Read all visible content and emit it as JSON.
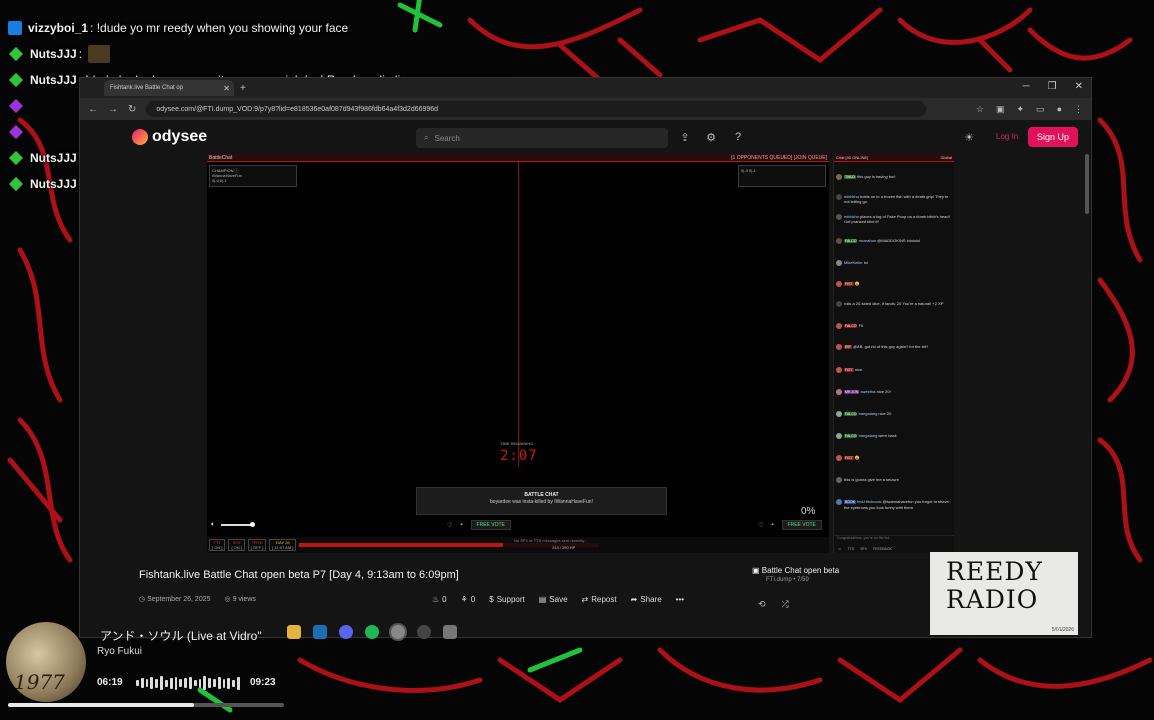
{
  "overlay_chat": [
    {
      "icon": "twitch",
      "user": "vizzyboi_1",
      "text": ": !dude yo mr reedy when you showing your face"
    },
    {
      "icon": "diamond-green",
      "user": "NutsJJJ",
      "text": ":"
    },
    {
      "icon": "diamond-green",
      "user": "NutsJJJ",
      "text": ": !dude ha ha ha aye man its your special day! Reedy radio live wowowowowoeee"
    },
    {
      "icon": "diamond-purple",
      "user": "",
      "text": ""
    },
    {
      "icon": "diamond-purple",
      "user": "",
      "text": ""
    },
    {
      "icon": "diamond-green",
      "user": "NutsJJJ",
      "text": ":"
    },
    {
      "icon": "diamond-green",
      "user": "NutsJJJ",
      "text": ":"
    }
  ],
  "browser": {
    "tab_title": "Fishtank.live Battle Chat op",
    "url": "odysee.com/@FTI.dump_VOD:9/p7y8?lid=e818536e0af087d943f986fdb64a4f3d2d66996d"
  },
  "site": {
    "logo": "odysee",
    "search_placeholder": "Search",
    "login": "Log In",
    "signup": "Sign Up"
  },
  "player": {
    "header_left": "BattleChat",
    "header_right": "[1 OPPONENTS QUEUED] [JOIN QUEUE]",
    "champion_label": "CHAMPION ⓘ",
    "champion_name": "IWannaHaveFun",
    "champion_stats": "0|-0  0|-1",
    "opponent_label": "",
    "opponent_stats": "0|-0  0|-1",
    "time_label": "TIME REMAINING",
    "time_value": "2:07",
    "box_title": "BATTLE CHAT",
    "box_text": "boyardee was insta-killed by IWannaHaveFun!",
    "percent": "0%",
    "free_vote": "FREE VOTE",
    "stats": [
      {
        "key": "TTT",
        "val": "[ ON ]",
        "cls": "k"
      },
      {
        "key": "SFX",
        "val": "[ ON ]",
        "cls": "k"
      },
      {
        "key": "TRYD",
        "val": "[ OFF ]",
        "cls": "k"
      },
      {
        "key": "DAY 26",
        "val": "[ 11:07 AM ]",
        "cls": "ky"
      }
    ],
    "strip_note": "No SFX or TTS messages sent recently...",
    "strip_count": "244 / 350 HP",
    "hp_fraction": 0.68
  },
  "chat": {
    "header_left": "Chat [30 ONLINE]",
    "header_right": "Global",
    "messages": [
      {
        "badge": "TWLD",
        "badge_color": "#3b6b2b",
        "user": "",
        "text": "this guy is having fun!"
      },
      {
        "badge": "",
        "badge_color": "",
        "user": "mikhkhu",
        "text": "holds on to a frozen fish with a death grip! They're not letting go."
      },
      {
        "badge": "",
        "badge_color": "",
        "user": "mikhkhu",
        "text": "places a log of Fake Poop on a dumb bitch's head! Get pranked bitch!!!"
      },
      {
        "badge": "FALCO",
        "badge_color": "#2d6a2d",
        "user": "mcmahon",
        "text": "@MADDOKINS lolololol"
      },
      {
        "badge": "",
        "badge_color": "",
        "user": "MikeKeller",
        "text": "lol"
      },
      {
        "badge": "FIST",
        "badge_color": "#8a1f1f",
        "user": "",
        "text": "😀"
      },
      {
        "badge": "",
        "badge_color": "",
        "user": "",
        "text": "rolls a 20-sided dice. It lands: 20 You're a natural! +2 XP"
      },
      {
        "badge": "FALCO",
        "badge_color": "#8a1f1f",
        "user": "",
        "text": "F5"
      },
      {
        "badge": "RIP",
        "badge_color": "#8a1f1f",
        "user": "",
        "text": "@AB. got rid of this guy again? for the bit?"
      },
      {
        "badge": "FIST",
        "badge_color": "#8a1f1f",
        "user": "",
        "text": "nice"
      },
      {
        "badge": "MR.JON",
        "badge_color": "#6a2d8a",
        "user": "sweetha",
        "text": "nice 20!"
      },
      {
        "badge": "FALCO",
        "badge_color": "#2d6a2d",
        "user": "bangalang",
        "text": "nice 20"
      },
      {
        "badge": "FALCO",
        "badge_color": "#2d6a2d",
        "user": "bangalang",
        "text": "were back"
      },
      {
        "badge": "FIST",
        "badge_color": "#8a1f1f",
        "user": "",
        "text": "😀"
      },
      {
        "badge": "",
        "badge_color": "",
        "user": "",
        "text": "this is gonna give me a seizure"
      },
      {
        "badge": "BOOK",
        "badge_color": "#2d4a8a",
        "user": "ted-Hitchcock",
        "text": "@iwannahavefun you forgot to shave the eyebrows you look funny with them"
      }
    ],
    "input_placeholder": "Congratulations, you're on the list...",
    "footer": [
      "TTS",
      "SFX",
      "FEEDBACK"
    ]
  },
  "video": {
    "title": "Fishtank.live Battle Chat open beta P7 [Day 4, 9:13am to 6:09pm]",
    "date": "September 26, 2025",
    "views": "9 views",
    "fire_count": "0",
    "slime_count": "0",
    "support": "Support",
    "save": "Save",
    "repost": "Repost",
    "share": "Share",
    "more": "•••"
  },
  "playlist": {
    "title": "Battle Chat open beta",
    "sub": "FTI.dump • 7/59"
  },
  "reedy": {
    "line1": "REEDY",
    "line2": "RADIO",
    "date": "5/01/2026"
  },
  "music": {
    "title": "アンド・ソウル (Live at Vidro\"",
    "artist": "Ryo Fukui",
    "elapsed": "06:19",
    "total": "09:23",
    "year": "1977",
    "progress": 0.673
  },
  "colors": {
    "accent": "#e1115a",
    "red": "#c81a1a",
    "chatbg": "#0f0f0f"
  }
}
